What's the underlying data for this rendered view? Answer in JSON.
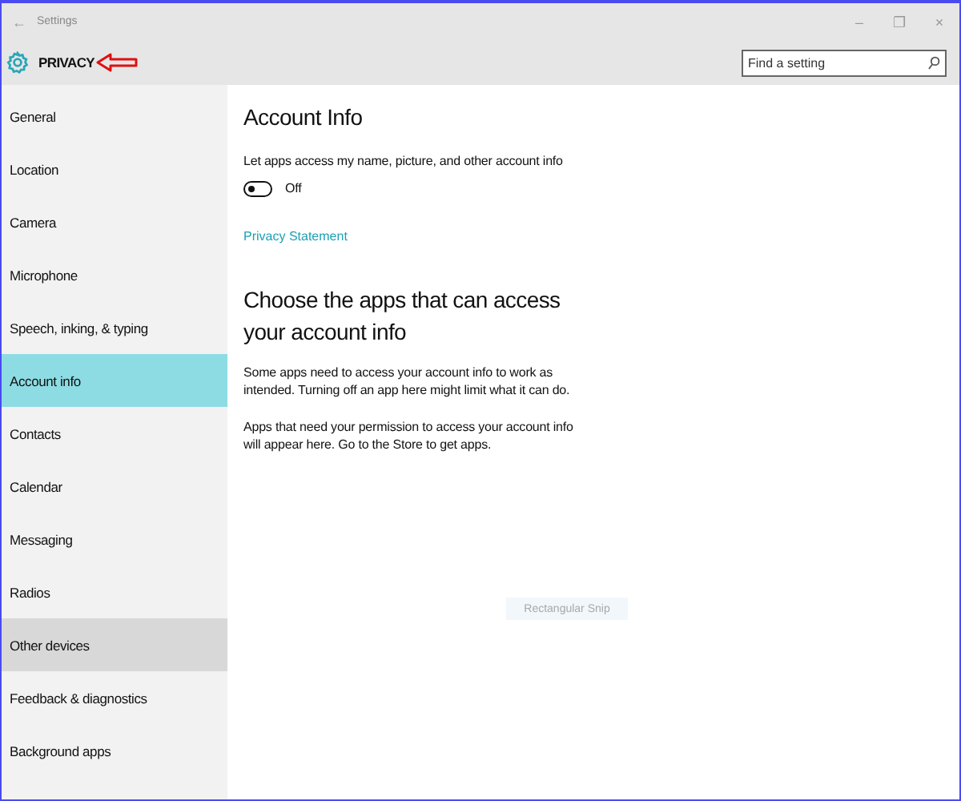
{
  "window": {
    "title": "Settings",
    "back": "←",
    "minimize": "–",
    "maximize": "❐",
    "close": "×"
  },
  "header": {
    "title": "PRIVACY",
    "search": {
      "placeholder": "Find a setting"
    }
  },
  "sidebar": {
    "items": [
      {
        "label": "General",
        "selected": false,
        "hovered": false
      },
      {
        "label": "Location",
        "selected": false,
        "hovered": false
      },
      {
        "label": "Camera",
        "selected": false,
        "hovered": false
      },
      {
        "label": "Microphone",
        "selected": false,
        "hovered": false
      },
      {
        "label": "Speech, inking, & typing",
        "selected": false,
        "hovered": false
      },
      {
        "label": "Account info",
        "selected": true,
        "hovered": false
      },
      {
        "label": "Contacts",
        "selected": false,
        "hovered": false
      },
      {
        "label": "Calendar",
        "selected": false,
        "hovered": false
      },
      {
        "label": "Messaging",
        "selected": false,
        "hovered": false
      },
      {
        "label": "Radios",
        "selected": false,
        "hovered": false
      },
      {
        "label": "Other devices",
        "selected": false,
        "hovered": true
      },
      {
        "label": "Feedback & diagnostics",
        "selected": false,
        "hovered": false
      },
      {
        "label": "Background apps",
        "selected": false,
        "hovered": false
      }
    ]
  },
  "content": {
    "heading": "Account Info",
    "setting_label": "Let apps access my name, picture, and other account info",
    "toggle": {
      "on": false,
      "state_label": "Off"
    },
    "link": "Privacy Statement",
    "section_heading": "Choose the apps that can access your account info",
    "paragraphs": [
      "Some apps need to access your account info to work as intended. Turning off an app here might limit what it can do.",
      "Apps that need your permission to access your account info will appear here. Go to the Store to get apps."
    ],
    "snip_button": "Rectangular Snip"
  }
}
